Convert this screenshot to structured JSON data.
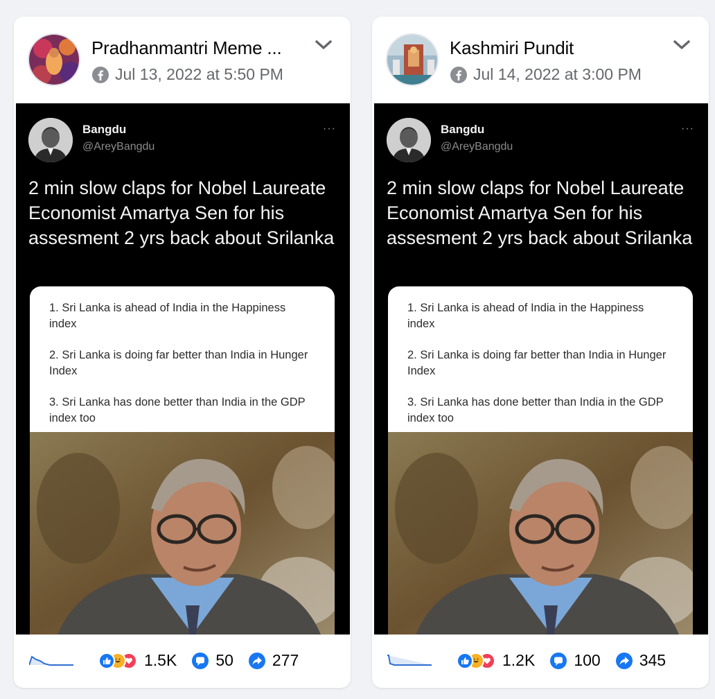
{
  "posts": [
    {
      "page_name": "Pradhanmantri Meme ...",
      "timestamp": "Jul 13, 2022 at 5:50 PM",
      "tweet": {
        "name": "Bangdu",
        "handle": "@AreyBangdu",
        "more": "···",
        "text": "2 min slow claps for Nobel Laureate Economist Amartya Sen for his assesment 2 yrs back about Srilanka",
        "quote_lines": [
          "1. Sri Lanka is ahead of India in the Happiness index",
          "2. Sri Lanka is doing far better than India in Hunger Index",
          "3. Sri Lanka has done better than India in the GDP index too"
        ]
      },
      "stats": {
        "reactions": "1.5K",
        "comments": "50",
        "shares": "277"
      }
    },
    {
      "page_name": "Kashmiri Pundit",
      "timestamp": "Jul 14, 2022 at 3:00 PM",
      "tweet": {
        "name": "Bangdu",
        "handle": "@AreyBangdu",
        "more": "···",
        "text": "2 min slow claps for Nobel Laureate Economist Amartya Sen for his assesment 2 yrs back about Srilanka",
        "quote_lines": [
          "1. Sri Lanka is ahead of India in the Happiness index",
          "2. Sri Lanka is doing far better than India in Hunger Index",
          "3. Sri Lanka has done better than India in the GDP index too"
        ]
      },
      "stats": {
        "reactions": "1.2K",
        "comments": "100",
        "shares": "345"
      }
    }
  ],
  "icons": {
    "platform": "facebook-icon",
    "menu": "chevron-down-icon",
    "reactions": [
      "like-reaction-icon",
      "haha-reaction-icon",
      "love-reaction-icon"
    ],
    "comment": "comment-icon",
    "share": "share-icon",
    "trend": "sparkline-icon"
  },
  "colors": {
    "accent": "#1877f2",
    "background": "#f0f2f5",
    "muted_text": "#65676b"
  }
}
